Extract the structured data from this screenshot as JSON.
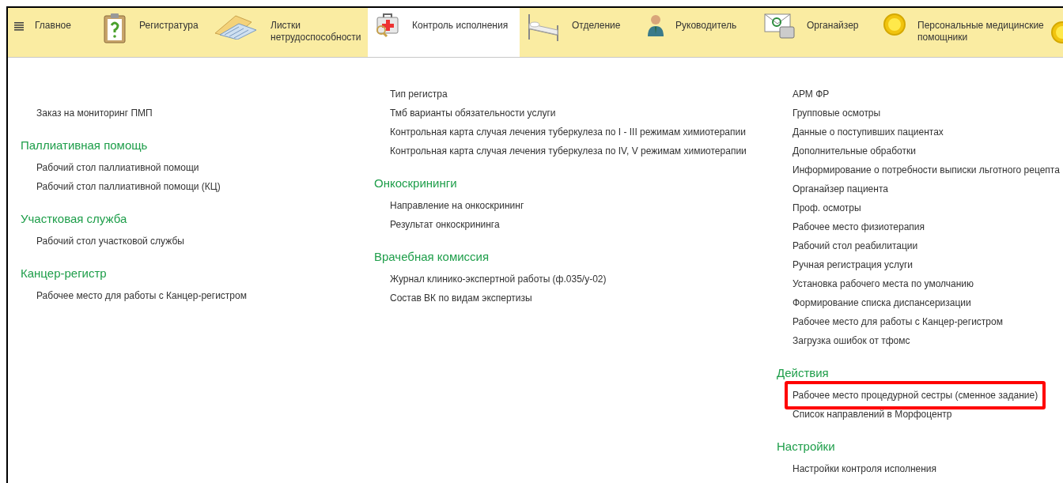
{
  "nav": [
    {
      "label": "Главное",
      "selected": false
    },
    {
      "label": "Регистратура",
      "selected": false
    },
    {
      "label": "Листки нетрудоспособности",
      "selected": false
    },
    {
      "label": "Контроль исполнения",
      "selected": true
    },
    {
      "label": "Отделение",
      "selected": false
    },
    {
      "label": "Руководитель",
      "selected": false
    },
    {
      "label": "Органайзер",
      "selected": false
    },
    {
      "label": "Персональные медицинские помощники",
      "selected": false
    }
  ],
  "columns": [
    [
      {
        "items": [
          {
            "label": "Заказ на мониторинг ПМП"
          }
        ]
      },
      {
        "heading": "Паллиативная помощь",
        "items": [
          {
            "label": "Рабочий стол паллиативной помощи"
          },
          {
            "label": "Рабочий стол паллиативной помощи (КЦ)"
          }
        ]
      },
      {
        "heading": "Участковая служба",
        "items": [
          {
            "label": "Рабочий стол участковой службы"
          }
        ]
      },
      {
        "heading": "Канцер-регистр",
        "items": [
          {
            "label": "Рабочее место для работы с Канцер-регистром"
          }
        ]
      }
    ],
    [
      {
        "items": [
          {
            "label": "Тип регистра"
          },
          {
            "label": "Тмб варианты обязательности услуги"
          },
          {
            "label": "Контрольная карта случая лечения туберкулеза по I - III режимам химиотерапии"
          },
          {
            "label": "Контрольная карта случая лечения туберкулеза по IV, V режимам химиотерапии"
          }
        ]
      },
      {
        "heading": "Онкоскрининги",
        "items": [
          {
            "label": "Направление на онкоскрининг"
          },
          {
            "label": "Результат онкоскрининга"
          }
        ]
      },
      {
        "heading": "Врачебная комиссия",
        "items": [
          {
            "label": "Журнал клинико-экспертной работы (ф.035/у-02)"
          },
          {
            "label": "Состав ВК по видам экспертизы"
          }
        ]
      }
    ],
    [
      {
        "items": [
          {
            "label": "АРМ ФР"
          },
          {
            "label": "Групповые осмотры"
          },
          {
            "label": "Данные о поступивших пациентах"
          },
          {
            "label": "Дополнительные обработки"
          },
          {
            "label": "Информирование о потребности выписки льготного рецепта"
          },
          {
            "label": "Органайзер пациента"
          },
          {
            "label": "Проф. осмотры"
          },
          {
            "label": "Рабочее место физиотерапия"
          },
          {
            "label": "Рабочий стол реабилитации"
          },
          {
            "label": "Ручная регистрация услуги"
          },
          {
            "label": "Установка рабочего места по умолчанию"
          },
          {
            "label": "Формирование списка диспансеризации"
          },
          {
            "label": "Рабочее место для работы с Канцер-регистром"
          },
          {
            "label": "Загрузка ошибок от тфомс"
          }
        ]
      },
      {
        "heading": "Действия",
        "items": [
          {
            "label": "Рабочее место процедурной сестры (сменное задание)",
            "highlighted": true
          },
          {
            "label": "Список направлений в Морфоцентр",
            "highlighted": false
          }
        ]
      },
      {
        "heading": "Настройки",
        "items": [
          {
            "label": "Настройки контроля исполнения"
          }
        ]
      }
    ]
  ]
}
